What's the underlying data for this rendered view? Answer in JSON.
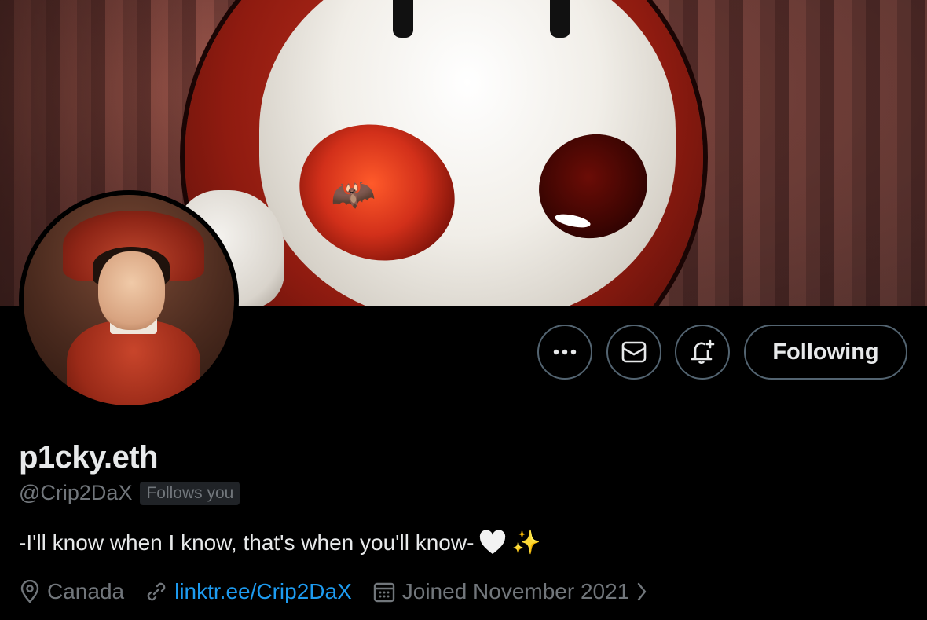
{
  "profile": {
    "display_name": "p1cky.eth",
    "handle": "@Crip2DaX",
    "follows_you_badge": "Follows you",
    "bio": "-I'll know when I know, that's when you'll know-",
    "location": "Canada",
    "website": "linktr.ee/Crip2DaX",
    "joined": "Joined November 2021"
  },
  "actions": {
    "more_icon": "more-icon",
    "message_icon": "envelope-icon",
    "notify_icon": "bell-plus-icon",
    "following_label": "Following"
  },
  "colors": {
    "background": "#000000",
    "text_primary": "#e7e9ea",
    "text_secondary": "#71767b",
    "link": "#1d9bf0",
    "border": "#536471"
  }
}
